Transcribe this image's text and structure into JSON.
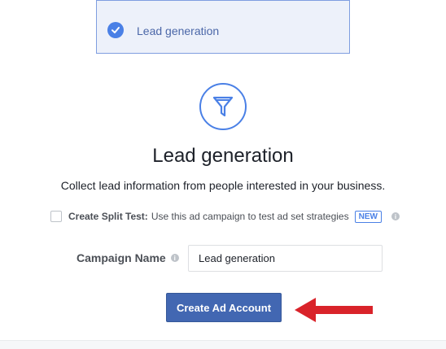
{
  "objective": {
    "label": "Lead generation",
    "icon": "check-circle-icon"
  },
  "header": {
    "icon": "funnel-icon",
    "title": "Lead generation",
    "description": "Collect lead information from people interested in your business."
  },
  "split_test": {
    "checked": false,
    "title": "Create Split Test:",
    "description": "Use this ad campaign to test ad set strategies",
    "badge": "NEW",
    "info_icon": "i"
  },
  "campaign_name": {
    "label": "Campaign Name",
    "info_icon": "i",
    "value": "Lead generation"
  },
  "actions": {
    "create_label": "Create Ad Account"
  },
  "colors": {
    "accent": "#4a80e6",
    "button": "#4267b2",
    "annotation_arrow": "#d9232a"
  }
}
